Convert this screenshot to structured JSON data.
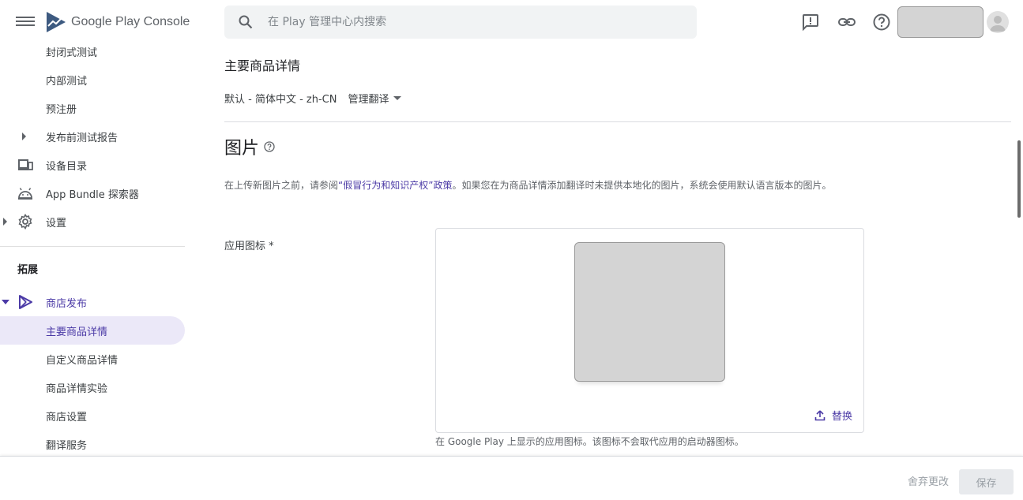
{
  "app": {
    "name_google": "Google Play",
    "name_console": "Console"
  },
  "search": {
    "placeholder": "在 Play 管理中心内搜索"
  },
  "sidebar": {
    "items": [
      {
        "label": "封闭式测试"
      },
      {
        "label": "内部测试"
      },
      {
        "label": "预注册"
      },
      {
        "label": "发布前测试报告"
      },
      {
        "label": "设备目录"
      },
      {
        "label": "App Bundle 探索器"
      },
      {
        "label": "设置"
      }
    ],
    "section": "拓展",
    "store_label": "商店发布",
    "store_items": [
      {
        "label": "主要商品详情",
        "selected": true
      },
      {
        "label": "自定义商品详情"
      },
      {
        "label": "商品详情实验"
      },
      {
        "label": "商店设置"
      },
      {
        "label": "翻译服务"
      }
    ]
  },
  "main": {
    "page_title": "主要商品详情",
    "lang_default": "默认 - 简体中文 - zh-CN",
    "lang_manage": "管理翻译",
    "section_title": "图片",
    "notice_pre": "在上传新图片之前，请参阅",
    "notice_link": "“假冒行为和知识产权”政策",
    "notice_post": "。如果您在为商品详情添加翻译时未提供本地化的图片，系统会使用默认语言版本的图片。",
    "app_icon_label": "应用图标 *",
    "replace_label": "替换",
    "helper": "在 Google Play 上显示的应用图标。该图标不会取代应用的启动器图标。"
  },
  "footer": {
    "discard": "舍弃更改",
    "save": "保存"
  },
  "colors": {
    "accent": "#4b3aa6",
    "selected_bg": "#ebe8f8"
  }
}
